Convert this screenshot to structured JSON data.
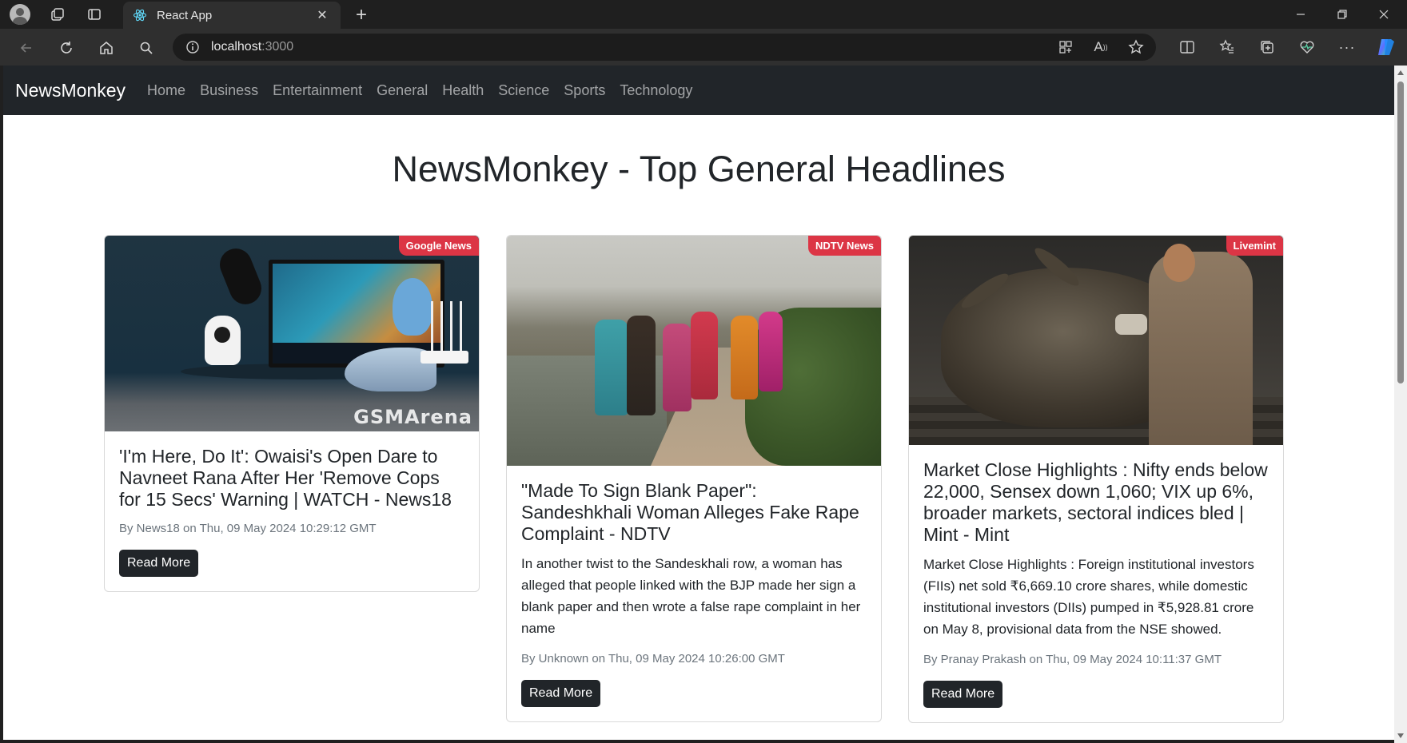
{
  "browser": {
    "tab_title": "React App",
    "url_host": "localhost",
    "url_port": ":3000",
    "icons": [
      "profile-avatar-icon",
      "workspaces-icon",
      "tab-actions-icon",
      "react-favicon",
      "close-icon",
      "plus-icon",
      "minimize-icon",
      "restore-icon",
      "window-close-icon",
      "back-icon",
      "reload-icon",
      "home-icon",
      "search-icon",
      "site-info-icon",
      "app-available-icon",
      "read-aloud-icon",
      "favorite-star-icon",
      "split-screen-icon",
      "favorites-icon",
      "collections-icon",
      "browser-essentials-icon",
      "more-icon",
      "copilot-icon"
    ]
  },
  "navbar": {
    "brand": "NewsMonkey",
    "links": [
      "Home",
      "Business",
      "Entertainment",
      "General",
      "Health",
      "Science",
      "Sports",
      "Technology"
    ]
  },
  "page": {
    "title": "NewsMonkey - Top General Headlines"
  },
  "cards": [
    {
      "source": "Google News",
      "image_watermark": "GSMArena",
      "title": "'I'm Here, Do It': Owaisi's Open Dare to Navneet Rana After Her 'Remove Cops for 15 Secs' Warning | WATCH - News18",
      "description": "",
      "meta": "By News18 on Thu, 09 May 2024 10:29:12 GMT",
      "button": "Read More"
    },
    {
      "source": "NDTV News",
      "title": "\"Made To Sign Blank Paper\": Sandeshkhali Woman Alleges Fake Rape Complaint - NDTV",
      "description": "In another twist to the Sandeskhali row, a woman has alleged that people linked with the BJP made her sign a blank paper and then wrote a false rape complaint in her name",
      "meta": "By Unknown on Thu, 09 May 2024 10:26:00 GMT",
      "button": "Read More"
    },
    {
      "source": "Livemint",
      "title": "Market Close Highlights : Nifty ends below 22,000, Sensex down 1,060; VIX up 6%, broader markets, sectoral indices bled | Mint - Mint",
      "description": "Market Close Highlights : Foreign institutional investors (FIIs) net sold ₹6,669.10 crore shares, while domestic institutional investors (DIIs) pumped in ₹5,928.81 crore on May 8, provisional data from the NSE showed.",
      "meta": "By Pranay Prakash on Thu, 09 May 2024 10:11:37 GMT",
      "button": "Read More"
    }
  ],
  "colors": {
    "navbar_bg": "#212529",
    "badge_bg": "#dc3545",
    "button_bg": "#212529",
    "browser_chrome": "#1f1f1f"
  }
}
